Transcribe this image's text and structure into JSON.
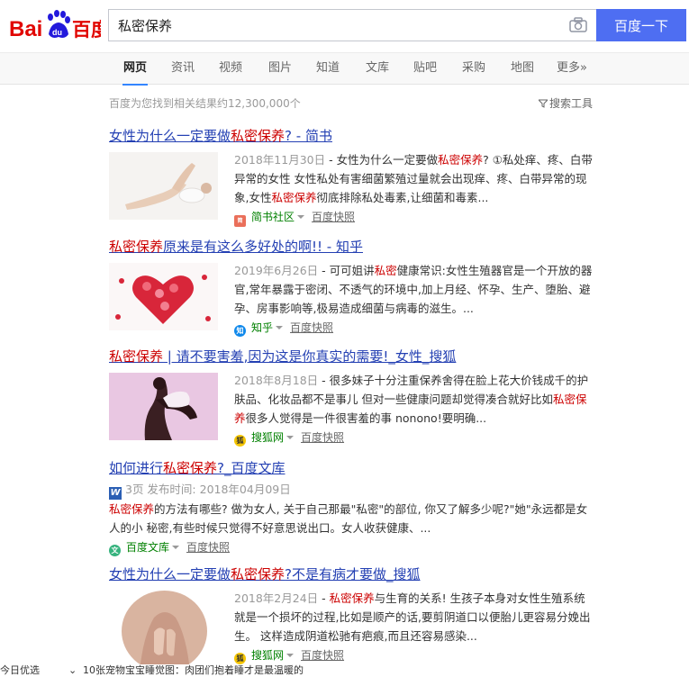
{
  "header": {
    "logo_text": "Bai百度",
    "search_query": "私密保养",
    "search_button": "百度一下"
  },
  "tabs": [
    {
      "label": "网页",
      "active": true
    },
    {
      "label": "资讯"
    },
    {
      "label": "视频"
    },
    {
      "label": "图片"
    },
    {
      "label": "知道"
    },
    {
      "label": "文库"
    },
    {
      "label": "贴吧"
    },
    {
      "label": "采购"
    },
    {
      "label": "地图"
    },
    {
      "label": "更多»"
    }
  ],
  "meta": {
    "result_count": "百度为您找到相关结果约12,300,000个",
    "tools": "搜索工具"
  },
  "results": [
    {
      "title_pre": "女性为什么一定要做",
      "title_em": "私密保养",
      "title_post": "? - 简书",
      "date": "2018年11月30日",
      "snippet_1": " - 女性为什么一定要做",
      "snippet_em1": "私密保养",
      "snippet_2": "? ①私处痒、疼、白带异常的女性 女性私处有害细菌繁殖过量就会出现痒、疼、白带异常的现象,女性",
      "snippet_em2": "私密保养",
      "snippet_3": "彻底排除私处毒素,让细菌和毒素...",
      "source": "简书社区",
      "snapshot": "百度快照",
      "icon": "jianshu-icon"
    },
    {
      "title_em": "私密保养",
      "title_post": "原来是有这么多好处的啊!! - 知乎",
      "date": "2019年6月26日",
      "snippet_1": " - 可可姐讲",
      "snippet_em1": "私密",
      "snippet_2": "健康常识:女性生殖器官是一个开放的器官,常年暴露于密闭、不透气的环境中,加上月经、怀孕、生产、堕胎、避孕、房事影响等,极易造成细菌与病毒的滋生。...",
      "source": "知乎",
      "snapshot": "百度快照",
      "icon": "zhihu-icon"
    },
    {
      "title_em": "私密保养",
      "title_post": " | 请不要害羞,因为这是你真实的需要!_女性_搜狐",
      "date": "2018年8月18日",
      "snippet_1": " - 很多妹子十分注重保养舍得在脸上花大价钱成千的护肤品、化妆品都不是事儿 但对一些健康问题却觉得凑合就好比如",
      "snippet_em1": "私密保养",
      "snippet_2": "很多人觉得是一件很害羞的事 nonono!要明确...",
      "source": "搜狐网",
      "snapshot": "百度快照",
      "icon": "sohu-icon"
    },
    {
      "title_pre": "如何进行",
      "title_em": "私密保养",
      "title_post": "?_百度文库",
      "doc_meta": "3页 发布时间: 2018年04月09日",
      "snippet_em1": "私密保养",
      "snippet_2": "的方法有哪些? 做为女人, 关于自己那最\"私密\"的部位, 你又了解多少呢?\"她\"永远都是女人的小 秘密,有些时候只觉得不好意思说出口。女人收获健康、...",
      "source": "百度文库",
      "snapshot": "百度快照",
      "icon": "wenku-icon"
    },
    {
      "title_pre": "女性为什么一定要做",
      "title_em": "私密保养",
      "title_post": "?不是有病才要做_搜狐",
      "date": "2018年2月24日",
      "snippet_1": " - ",
      "snippet_em1": "私密保养",
      "snippet_2": "与生育的关系! 生孩子本身对女性生殖系统就是一个损坏的过程,比如是顺产的话,要剪阴道口以便胎儿更容易分娩出生。 这样造成阴道松驰有疤痕,而且还容易感染...",
      "source": "搜狐网",
      "snapshot": "百度快照",
      "icon": "sohu-icon"
    }
  ],
  "bottom": {
    "text_1": "今日优选",
    "text_2": "10张宠物宝宝睡觉图：肉团们抱着睡才是最温暖的"
  },
  "colors": {
    "brand": "#4e6ef2",
    "link": "#2440b3",
    "highlight": "#c00",
    "source": "#008000"
  }
}
